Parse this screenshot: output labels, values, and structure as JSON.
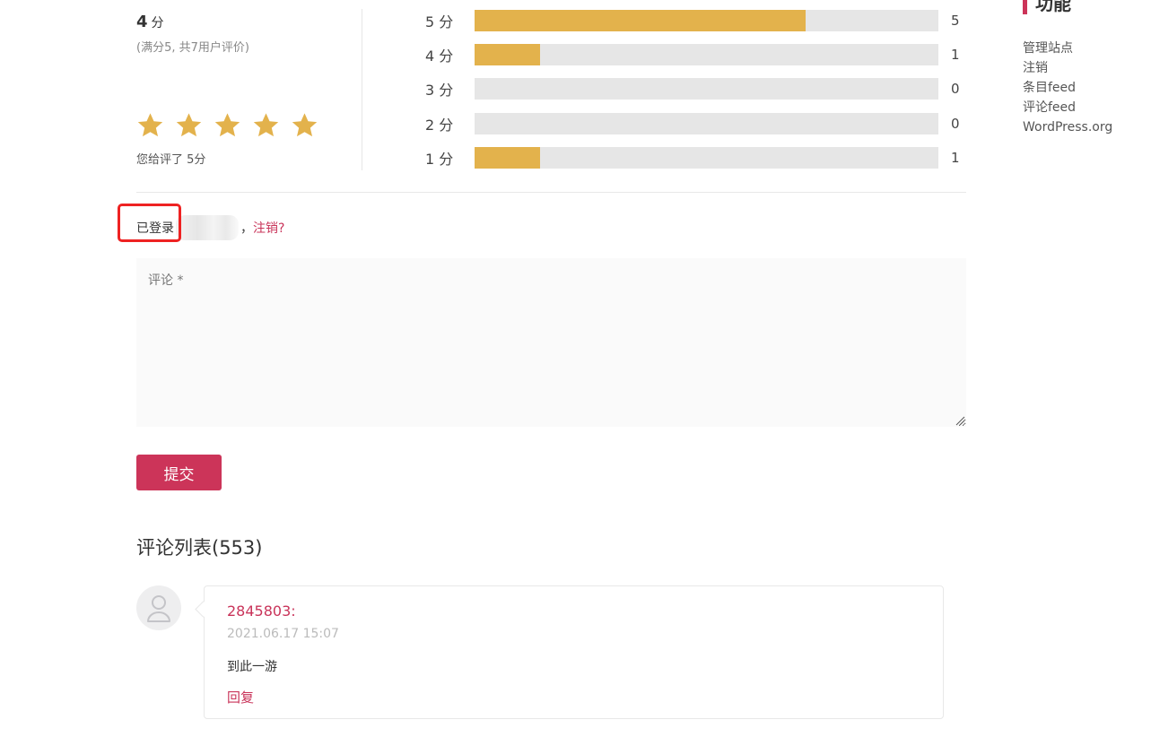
{
  "rating": {
    "score_value": "4",
    "score_unit": "分",
    "score_note": "(满分5, 共7用户评价)",
    "my_rating_text": "您给评了 5分",
    "my_rating_stars": 5,
    "star_color": "#e3b24c"
  },
  "distribution": [
    {
      "label": "5 分",
      "count": "5",
      "fraction": 0.714
    },
    {
      "label": "4 分",
      "count": "1",
      "fraction": 0.141
    },
    {
      "label": "3 分",
      "count": "0",
      "fraction": 0
    },
    {
      "label": "2 分",
      "count": "0",
      "fraction": 0
    },
    {
      "label": "1 分",
      "count": "1",
      "fraction": 0.141
    }
  ],
  "login": {
    "prefix": "已登录",
    "separator": "，",
    "logout_label": "注销?"
  },
  "comment_form": {
    "placeholder": "评论 *",
    "submit_label": "提交"
  },
  "comments": {
    "title": "评论列表(553)",
    "items": [
      {
        "author": "2845803:",
        "date": "2021.06.17 15:07",
        "text": "到此一游",
        "reply_label": "回复"
      }
    ]
  },
  "sidebar": {
    "title": "功能",
    "links": [
      "管理站点",
      "注销",
      "条目feed",
      "评论feed",
      "WordPress.org"
    ]
  },
  "colors": {
    "accent": "#cc3459",
    "bar_fill": "#e3b24c",
    "bar_track": "#e6e6e6"
  }
}
